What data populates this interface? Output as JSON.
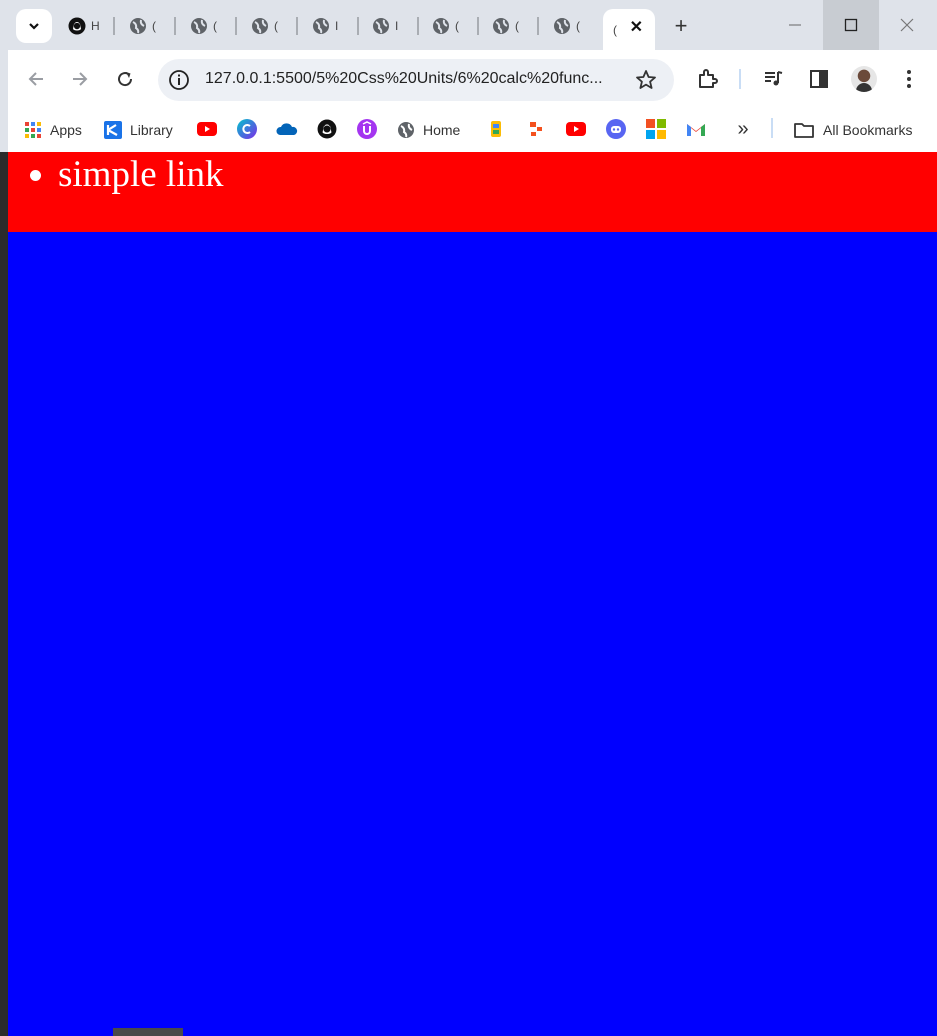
{
  "browser": {
    "tabs": [
      {
        "title": "H",
        "icon": "github-icon"
      },
      {
        "title": "(",
        "icon": "globe-icon"
      },
      {
        "title": "(",
        "icon": "globe-icon"
      },
      {
        "title": "(",
        "icon": "globe-icon"
      },
      {
        "title": "I",
        "icon": "globe-icon"
      },
      {
        "title": "I",
        "icon": "globe-icon"
      },
      {
        "title": "(",
        "icon": "globe-icon"
      },
      {
        "title": "(",
        "icon": "globe-icon"
      },
      {
        "title": "(",
        "icon": "globe-icon"
      }
    ],
    "active_tab": {
      "title": "(",
      "close": "✕"
    },
    "new_tab": "+",
    "url": "127.0.0.1:5500/5%20Css%20Units/6%20calc%20func...",
    "bookmarks": {
      "apps": "Apps",
      "library": "Library",
      "home": "Home",
      "more": "»",
      "all_bookmarks": "All Bookmarks"
    }
  },
  "page": {
    "nav_link": "simple link"
  },
  "colors": {
    "nav_background": "#ff0000",
    "page_background": "#0000ff",
    "link_text": "#ffffff"
  }
}
